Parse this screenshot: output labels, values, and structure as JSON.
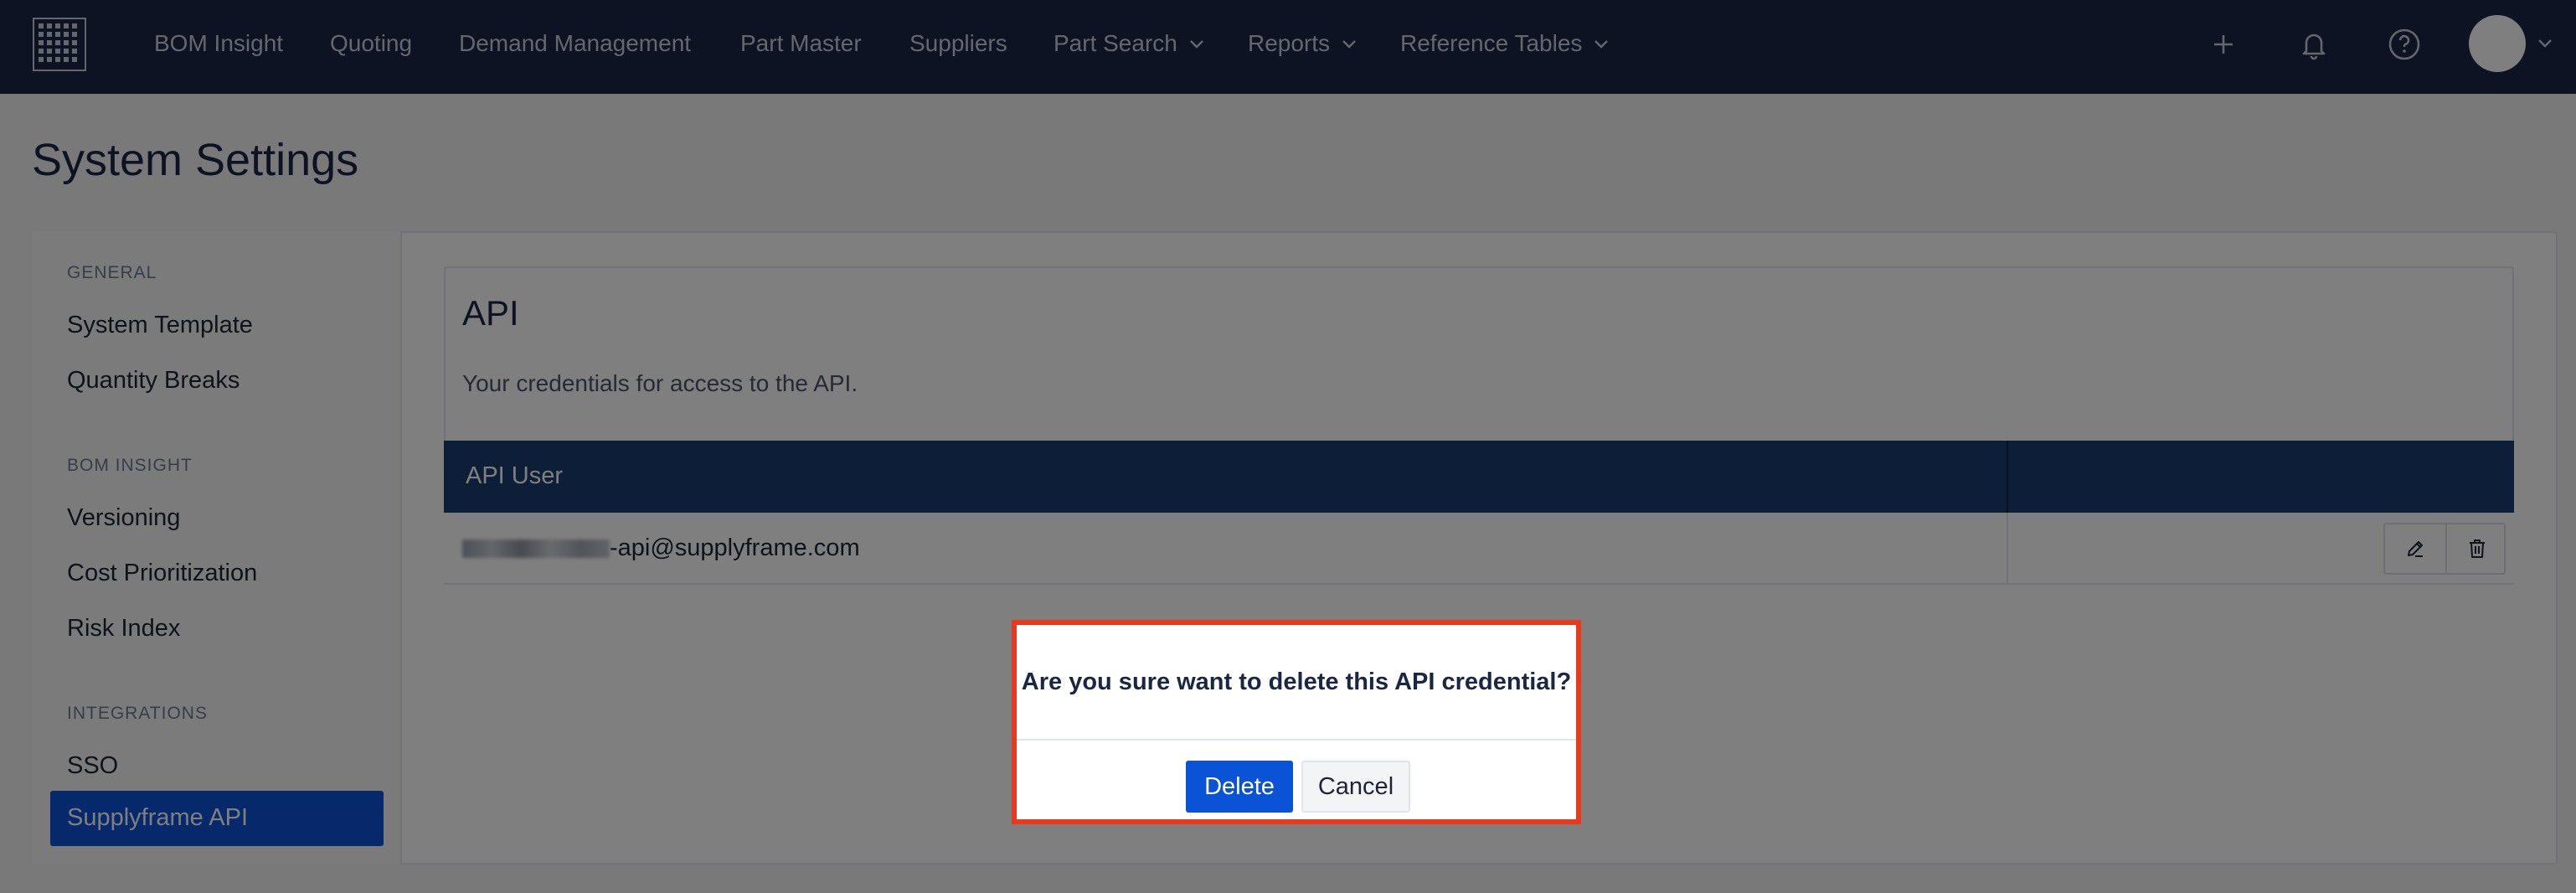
{
  "nav": {
    "logo_icon": "grid-logo-icon",
    "items": [
      {
        "label": "BOM Insight",
        "dropdown": false
      },
      {
        "label": "Quoting",
        "dropdown": false
      },
      {
        "label": "Demand Management",
        "dropdown": false
      },
      {
        "label": "Part Master",
        "dropdown": false
      },
      {
        "label": "Suppliers",
        "dropdown": false
      },
      {
        "label": "Part Search",
        "dropdown": true
      },
      {
        "label": "Reports",
        "dropdown": true
      },
      {
        "label": "Reference Tables",
        "dropdown": true
      }
    ],
    "right_icons": [
      "plus-icon",
      "bell-icon",
      "help-icon",
      "avatar",
      "chevron-down-icon"
    ]
  },
  "page": {
    "title": "System Settings"
  },
  "sidebar": {
    "sections": [
      {
        "heading": "GENERAL",
        "items": [
          "System Template",
          "Quantity Breaks"
        ]
      },
      {
        "heading": "BOM INSIGHT",
        "items": [
          "Versioning",
          "Cost Prioritization",
          "Risk Index"
        ]
      },
      {
        "heading": "INTEGRATIONS",
        "items": [
          "SSO",
          "Supplyframe API"
        ]
      }
    ],
    "active_item": "Supplyframe API"
  },
  "api": {
    "title": "API",
    "description": "Your credentials for access to the API.",
    "table": {
      "columns": [
        "API User",
        ""
      ],
      "rows": [
        {
          "user_suffix": "-api@supplyframe.com",
          "user_redacted": true,
          "actions": [
            "edit-icon",
            "trash-icon"
          ]
        }
      ]
    }
  },
  "modal": {
    "question": "Are you sure want to delete this API credential?",
    "confirm_label": "Delete",
    "cancel_label": "Cancel"
  },
  "colors": {
    "nav_bg": "#1a2744",
    "accent": "#0a52d6",
    "table_header": "#1a3d70",
    "modal_highlight": "#e8391d"
  }
}
